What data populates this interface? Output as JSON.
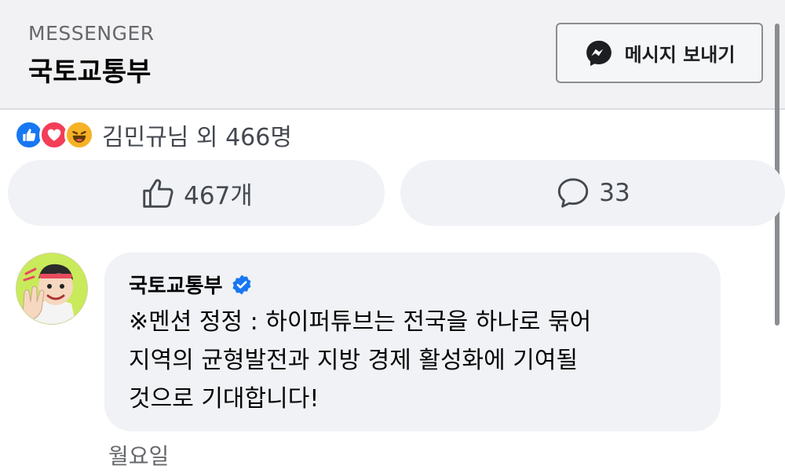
{
  "header": {
    "label": "MESSENGER",
    "page_name": "국토교통부",
    "send_message_label": "메시지 보내기"
  },
  "reactions": {
    "icons": [
      "like-icon",
      "love-icon",
      "haha-icon"
    ],
    "summary": "김민규님 외 466명"
  },
  "actions": {
    "like_count": "467개",
    "comment_count": "33"
  },
  "comment": {
    "author": "국토교통부",
    "verified": true,
    "lines": [
      "※멘션 정정 : 하이퍼튜브는 전국을 하나로 묶어",
      "지역의 균형발전과 지방 경제 활성화에 기여될",
      "것으로 기대합니다!"
    ],
    "time": "월요일"
  },
  "colors": {
    "header_bg": "#f2f2f4",
    "pill_bg": "#f0f2f5",
    "like_blue": "#1877f2",
    "love_red": "#f33e58",
    "haha_yellow": "#f7b125",
    "verified_blue": "#1877f2"
  }
}
